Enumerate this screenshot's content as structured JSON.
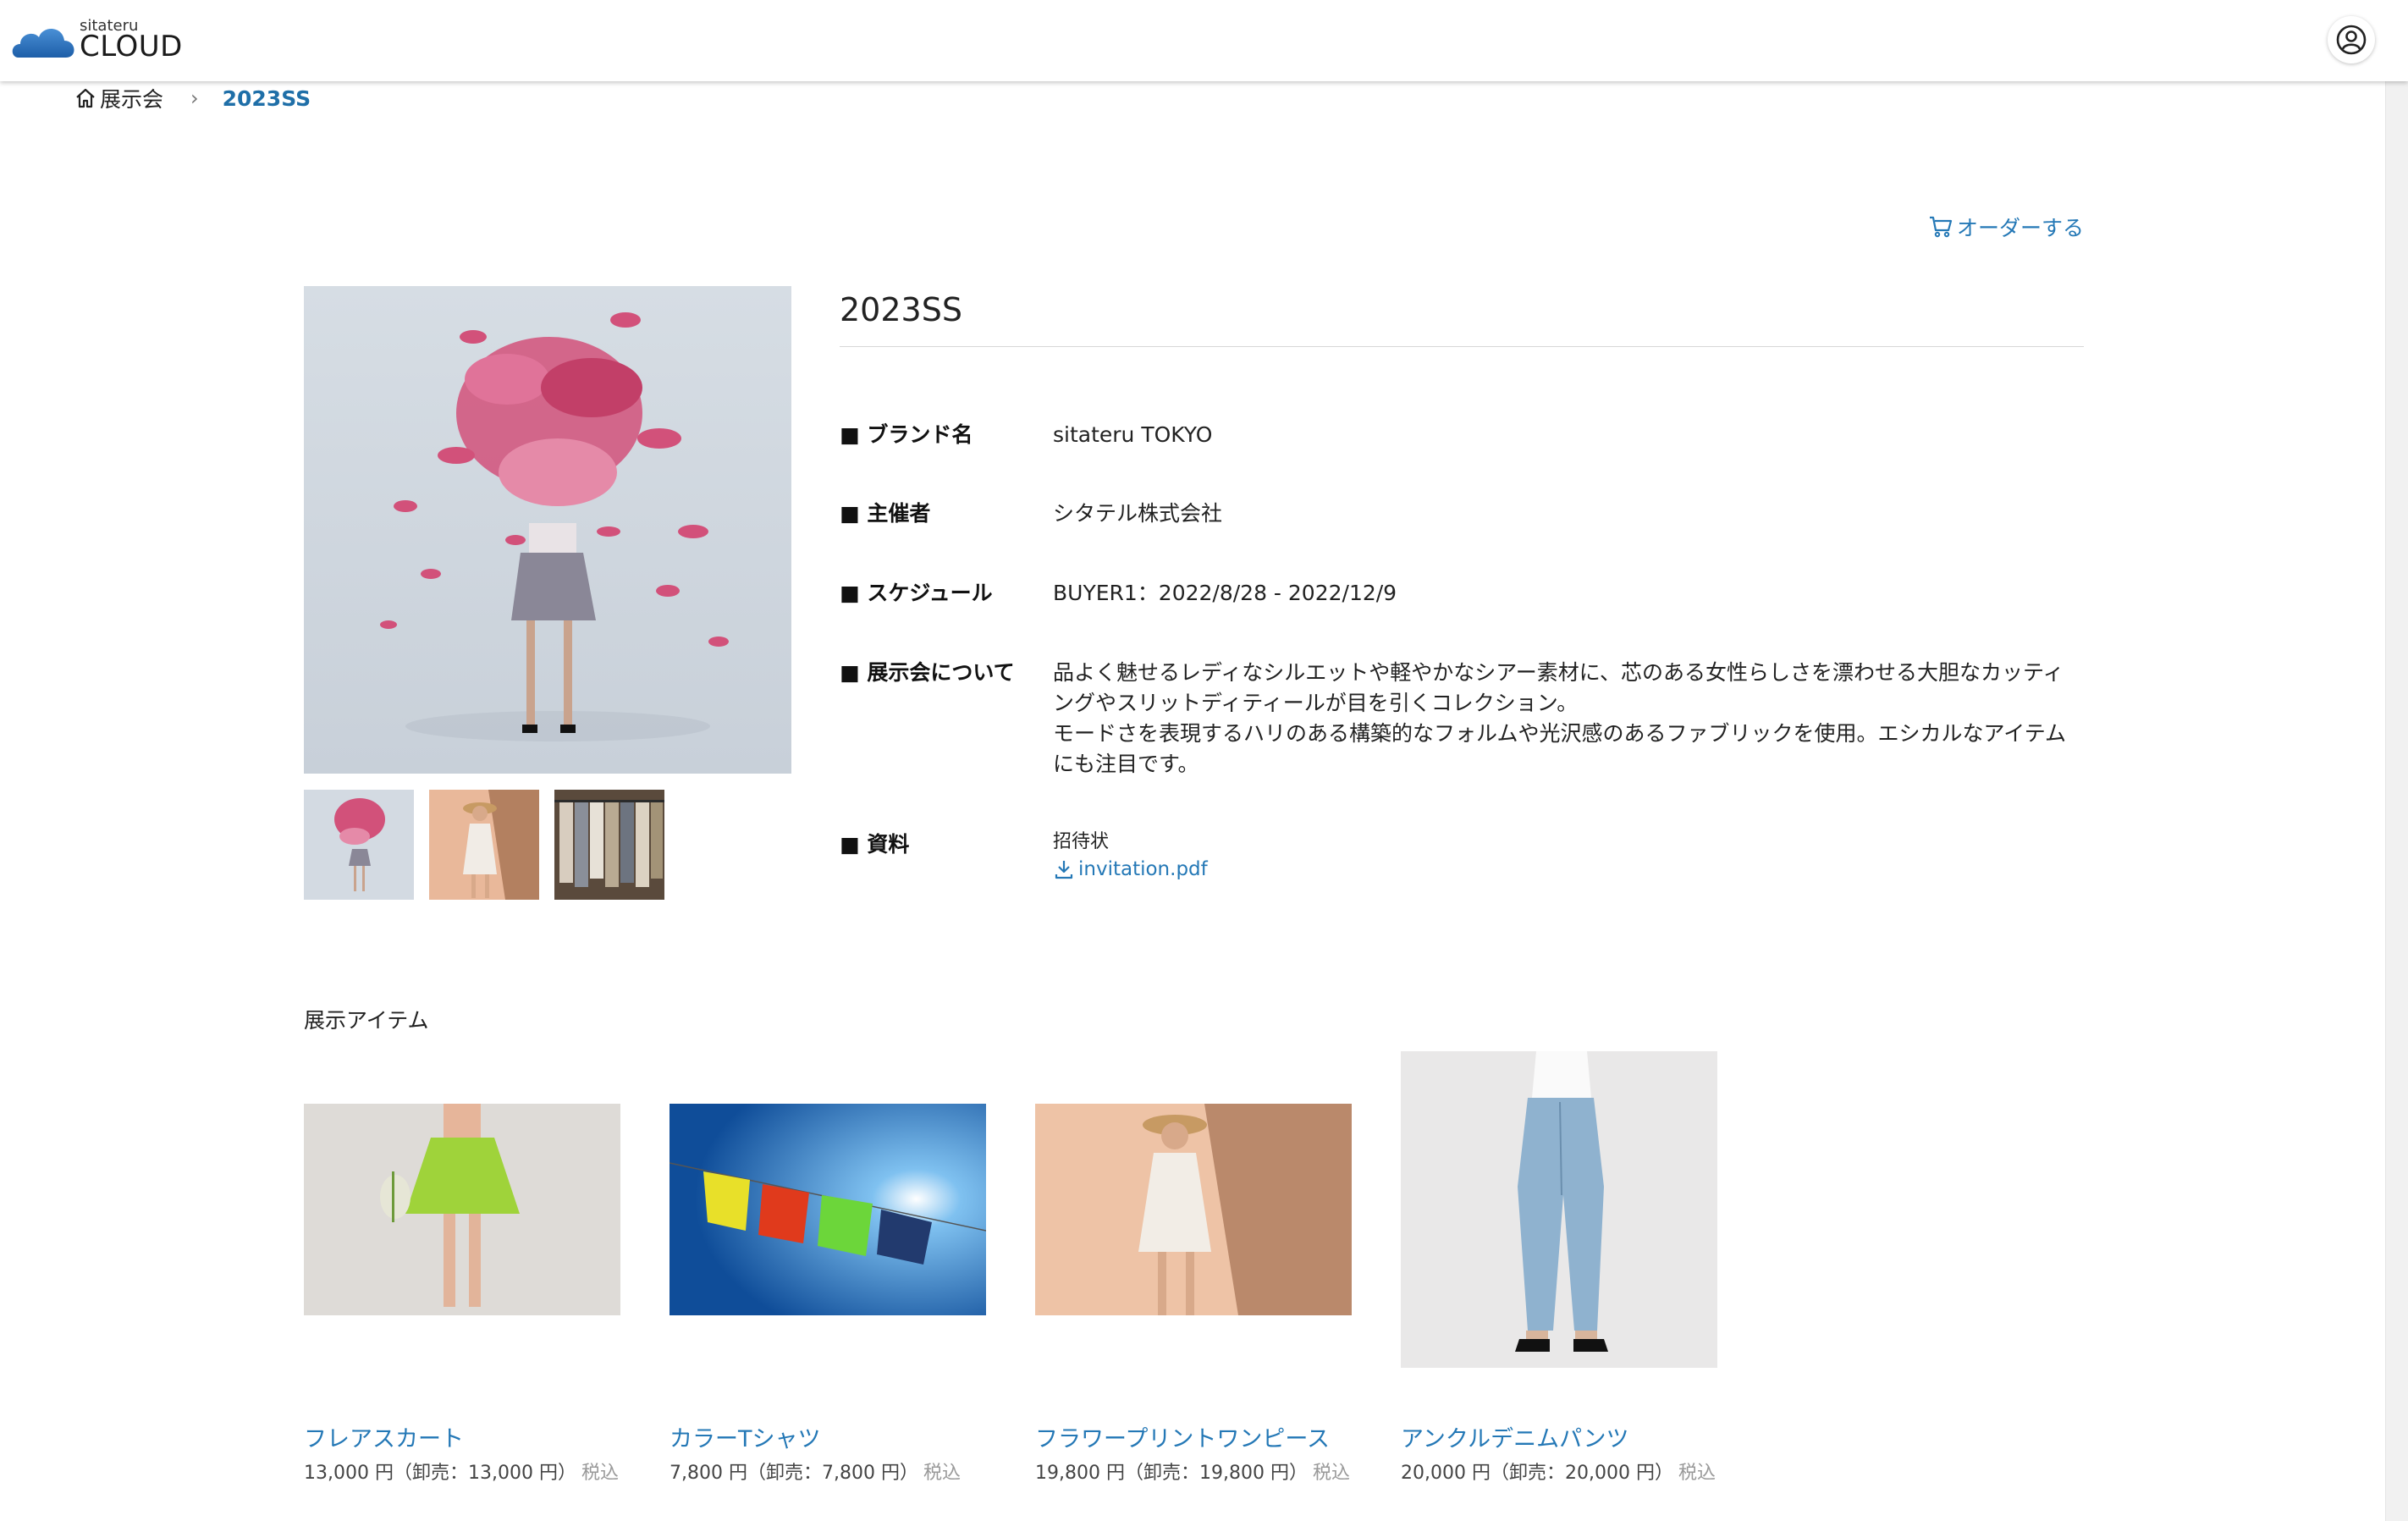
{
  "app": {
    "logo_small": "sitateru",
    "logo_big": "CLOUD"
  },
  "breadcrumb": {
    "home_label": "展示会",
    "current": "2023SS"
  },
  "order_link": "オーダーする",
  "exhibition": {
    "title": "2023SS",
    "rows": [
      {
        "label": "■ ブランド名",
        "value": "sitateru TOKYO"
      },
      {
        "label": "■ 主催者",
        "value": "シタテル株式会社"
      },
      {
        "label": "■ スケジュール",
        "value": "BUYER1：2022/8/28 - 2022/12/9"
      },
      {
        "label": "■ 展示会について",
        "value": "品よく魅せるレディなシルエットや軽やかなシアー素材に、芯のある女性らしさを漂わせる大胆なカッティングやスリットディティールが目を引くコレクション。\nモードさを表現するハリのある構築的なフォルムや光沢感のあるファブリックを使用。エシカルなアイテムにも注目です。"
      },
      {
        "label": "■ 資料",
        "caption": "招待状",
        "file": "invitation.pdf"
      }
    ]
  },
  "items_section_title": "展示アイテム",
  "items": [
    {
      "name": "フレアスカート",
      "price": "13,000 円（卸売：13,000 円）",
      "tax": "税込"
    },
    {
      "name": "カラーTシャツ",
      "price": "7,800 円（卸売：7,800 円）",
      "tax": "税込"
    },
    {
      "name": "フラワープリントワンピース",
      "price": "19,800 円（卸売：19,800 円）",
      "tax": "税込"
    },
    {
      "name": "アンクルデニムパンツ",
      "price": "20,000 円（卸売：20,000 円）",
      "tax": "税込"
    }
  ],
  "colors": {
    "accent": "#2478b6",
    "breadcrumb_current": "#1f6fa8",
    "logo_cloud": "#2a6db3"
  },
  "icons": [
    "logo-cloud-icon",
    "user-account-icon",
    "home-icon",
    "chevron-right-icon",
    "cart-icon",
    "download-icon"
  ]
}
